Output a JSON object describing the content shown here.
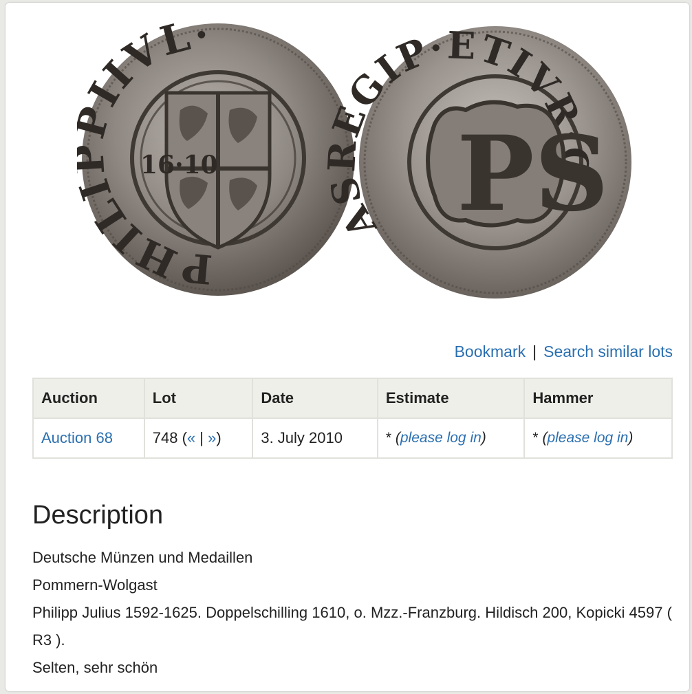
{
  "actions": {
    "bookmark": "Bookmark",
    "separator": "|",
    "search_similar": "Search similar lots"
  },
  "coin_image": {
    "obverse_legend": "PHILIPPIIVL·D·G·D",
    "obverse_date": "16·10",
    "reverse_legend": "ASREGIP·ETIVR·CVNEMETIAS",
    "reverse_monogram": "PS"
  },
  "table": {
    "headers": [
      "Auction",
      "Lot",
      "Date",
      "Estimate",
      "Hammer"
    ],
    "row": {
      "auction": "Auction 68",
      "lot_number": "748 (",
      "prev": "«",
      "lot_sep": " | ",
      "next": "»",
      "lot_close": ")",
      "date": "3. July 2010",
      "estimate_star": "*",
      "estimate_open": "(",
      "estimate_login": "please log in",
      "estimate_close": ")",
      "hammer_star": "*",
      "hammer_open": "(",
      "hammer_login": "please log in",
      "hammer_close": ")"
    }
  },
  "description": {
    "title": "Description",
    "category": "Deutsche Münzen und Medaillen",
    "region": "Pommern-Wolgast",
    "text": "Philipp Julius 1592-1625. Doppelschilling 1610, o. Mzz.-Franzburg. Hildisch 200, Kopicki 4597 ( R3 ).",
    "grade": "Selten, sehr schön"
  }
}
